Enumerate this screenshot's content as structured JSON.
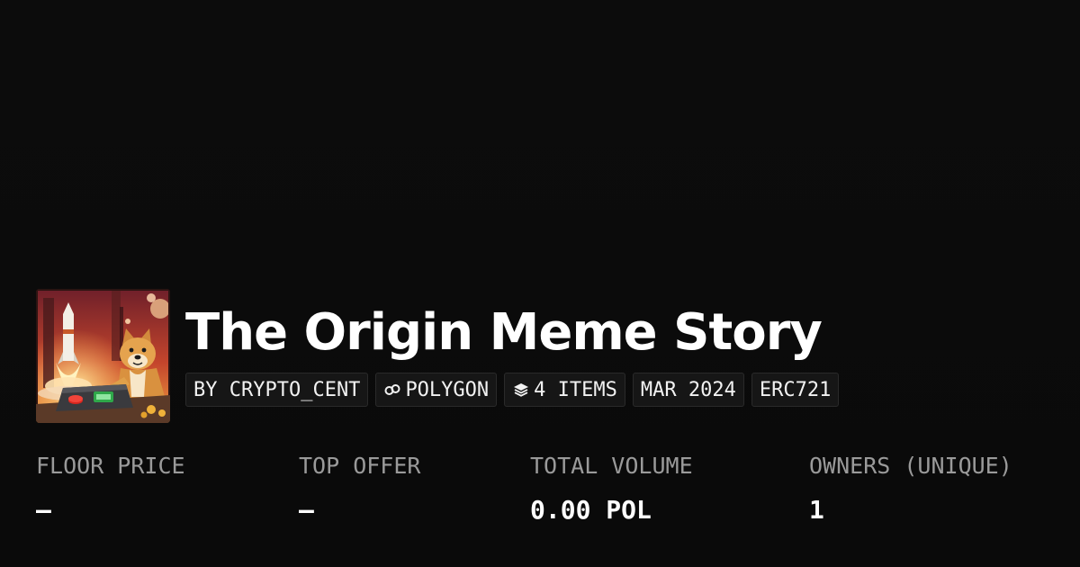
{
  "collection": {
    "title": "The Origin Meme Story",
    "avatar_icon": "doge-rocket-artwork",
    "chips": {
      "creator": "BY CRYPTO_CENT",
      "chain": "POLYGON",
      "chain_icon": "polygon-link-icon",
      "items": "4 ITEMS",
      "items_icon": "layers-icon",
      "date": "MAR 2024",
      "standard": "ERC721"
    }
  },
  "stats": {
    "floor_price": {
      "label": "FLOOR PRICE",
      "value": "–"
    },
    "top_offer": {
      "label": "TOP OFFER",
      "value": "–"
    },
    "total_volume": {
      "label": "TOTAL VOLUME",
      "value": "0.00 POL"
    },
    "owners": {
      "label": "OWNERS (UNIQUE)",
      "value": "1"
    }
  },
  "colors": {
    "background": "#0b0b0b",
    "chip_background": "#161616",
    "label": "#9a9a9a",
    "text": "#ffffff"
  }
}
